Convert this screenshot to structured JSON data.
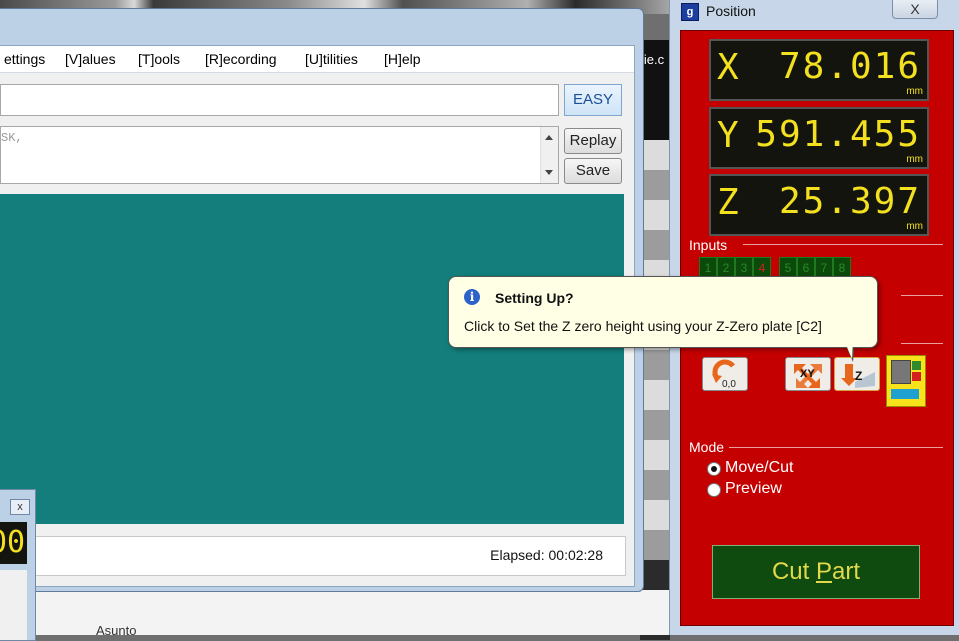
{
  "menubar": [
    "ettings",
    "[V]alues",
    "[T]ools",
    "[R]ecording",
    "[U]tilities",
    "[H]elp"
  ],
  "command": {
    "value": "",
    "easy_label": "EASY"
  },
  "log": {
    "text": "SK,"
  },
  "buttons": {
    "replay": "Replay",
    "save": "Save"
  },
  "status": {
    "elapsed": "Elapsed: 00:02:28"
  },
  "child_window": {
    "close": "x",
    "display": "00"
  },
  "background": {
    "link": "lie.c",
    "asunto": "Asunto"
  },
  "position_window": {
    "title": "Position",
    "close": "X",
    "dro": [
      {
        "axis": "X",
        "value": "78.016",
        "unit": "mm"
      },
      {
        "axis": "Y",
        "value": "591.455",
        "unit": "mm"
      },
      {
        "axis": "Z",
        "value": "25.397",
        "unit": "mm"
      }
    ],
    "inputs_label": "Inputs",
    "inputs": [
      {
        "label": "1",
        "active": false
      },
      {
        "label": "2",
        "active": false
      },
      {
        "label": "3",
        "active": false
      },
      {
        "label": "4",
        "active": true
      },
      {
        "label": "5",
        "active": false
      },
      {
        "label": "6",
        "active": false
      },
      {
        "label": "7",
        "active": false
      },
      {
        "label": "8",
        "active": false
      }
    ],
    "tool_icons": {
      "home_text": "0,0",
      "xy_text": "XY",
      "z_text": "Z"
    },
    "mode_label": "Mode",
    "modes": [
      {
        "label": "Move/Cut",
        "selected": true
      },
      {
        "label": "Preview",
        "selected": false
      }
    ],
    "cut_part": {
      "prefix": "Cut ",
      "underlined": "P",
      "rest": "art"
    }
  },
  "tooltip": {
    "title": "Setting Up?",
    "body": "Click to Set the Z zero height using your Z-Zero plate [C2]"
  },
  "colors": {
    "panel_red": "#c40000",
    "canvas_teal": "#137e7b",
    "dro_yellow": "#f3e11f",
    "cut_green": "#0f4a0f"
  }
}
